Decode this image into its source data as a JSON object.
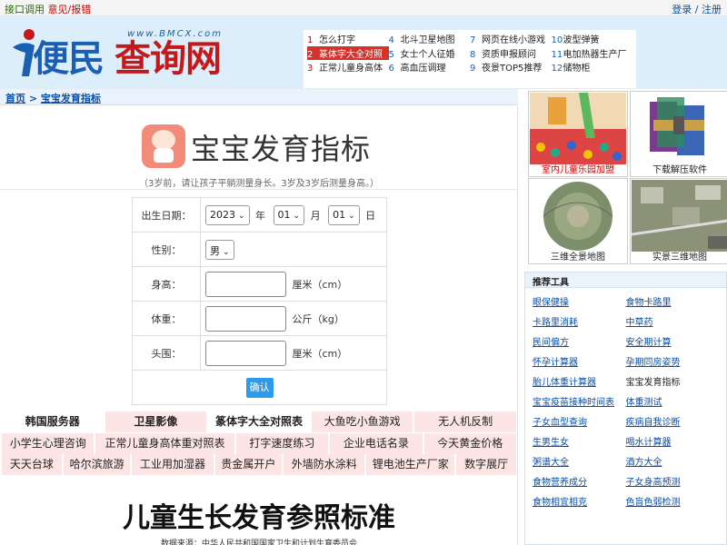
{
  "topbar": {
    "left_1": "接口调用",
    "left_2": "意见/报错",
    "right": "登录 / 注册"
  },
  "logo": {
    "word_1": "便民",
    "word_2": "查询网",
    "url": "www.BMCX.com"
  },
  "hot_list": [
    [
      {
        "n": "1",
        "t": "怎么打字"
      },
      {
        "n": "4",
        "t": "北斗卫星地图"
      },
      {
        "n": "7",
        "t": "网页在线小游戏"
      },
      {
        "n": "10",
        "t": "波型弹簧"
      }
    ],
    [
      {
        "n": "2",
        "t": "篆体字大全对照"
      },
      {
        "n": "5",
        "t": "女士个人征婚"
      },
      {
        "n": "8",
        "t": "资质申报顾问"
      },
      {
        "n": "11",
        "t": "电加热器生产厂"
      }
    ],
    [
      {
        "n": "3",
        "t": "正常儿童身高体"
      },
      {
        "n": "6",
        "t": "高血压调理"
      },
      {
        "n": "9",
        "t": "夜景TOP5推荐"
      },
      {
        "n": "12",
        "t": "储物柜"
      }
    ]
  ],
  "breadcrumb": {
    "home": "首页",
    "sep": " > ",
    "current": "宝宝发育指标"
  },
  "page": {
    "title": "宝宝发育指标",
    "subtitle": "（3岁前，请让孩子平躺测量身长。3岁及3岁后测量身高。）"
  },
  "form": {
    "birth_label": "出生日期：",
    "year_value": "2023",
    "year_unit": "年",
    "month_value": "01",
    "month_unit": "月",
    "day_value": "01",
    "day_unit": "日",
    "gender_label": "性别：",
    "gender_value": "男",
    "height_label": "身高：",
    "height_unit": "厘米（cm）",
    "weight_label": "体重：",
    "weight_unit": "公斤（kg）",
    "head_label": "头围：",
    "head_unit": "厘米（cm）",
    "submit": "确认"
  },
  "link_rows": [
    [
      {
        "t": "韩国服务器",
        "s": "b"
      },
      {
        "t": "卫星影像",
        "s": "b"
      },
      {
        "t": "篆体字大全对照表",
        "s": "b"
      },
      {
        "t": "大鱼吃小鱼游戏",
        "s": ""
      },
      {
        "t": "无人机反制",
        "s": ""
      }
    ],
    [
      {
        "t": "小学生心理咨询",
        "s": ""
      },
      {
        "t": "正常儿童身高体重对照表",
        "s": ""
      },
      {
        "t": "打字速度练习",
        "s": ""
      },
      {
        "t": "企业电话名录",
        "s": ""
      },
      {
        "t": "今天黄金价格",
        "s": ""
      }
    ],
    [
      {
        "t": "天天台球",
        "s": ""
      },
      {
        "t": "哈尔滨旅游",
        "s": ""
      },
      {
        "t": "工业用加湿器",
        "s": ""
      },
      {
        "t": "贵金属开户",
        "s": ""
      },
      {
        "t": "外墙防水涂料",
        "s": ""
      },
      {
        "t": "锂电池生产厂家",
        "s": ""
      },
      {
        "t": "数字展厅",
        "s": ""
      }
    ]
  ],
  "section": {
    "title": "儿童生长发育参照标准",
    "source": "数据来源：中华人民共和国国家卫生和计划生育委员会"
  },
  "ads": [
    {
      "caption": "室内儿童乐园加盟"
    },
    {
      "caption": "下载解压软件"
    },
    {
      "caption": "三维全景地图"
    },
    {
      "caption": "实景三维地图"
    }
  ],
  "tools": {
    "heading": "推荐工具",
    "items": [
      [
        "眼保健操",
        "食物卡路里"
      ],
      [
        "卡路里消耗",
        "中草药"
      ],
      [
        "民间偏方",
        "安全期计算"
      ],
      [
        "怀孕计算器",
        "孕期同房姿势"
      ],
      [
        "胎儿体重计算器",
        "宝宝发育指标"
      ],
      [
        "宝宝疫苗接种时间表",
        "体重测试"
      ],
      [
        "子女血型查询",
        "疾病自我诊断"
      ],
      [
        "生男生女",
        "喝水计算器"
      ],
      [
        "粥谱大全",
        "酒方大全"
      ],
      [
        "食物营养成分",
        "子女身高预测"
      ],
      [
        "食物相宜相克",
        "色盲色弱检测"
      ]
    ]
  },
  "colors": {
    "brand_blue": "#1a5fb4",
    "brand_red": "#c21a1a",
    "header_bg": "#dceefa",
    "link_bg": "#fde5e5",
    "button": "#2e9bea"
  }
}
